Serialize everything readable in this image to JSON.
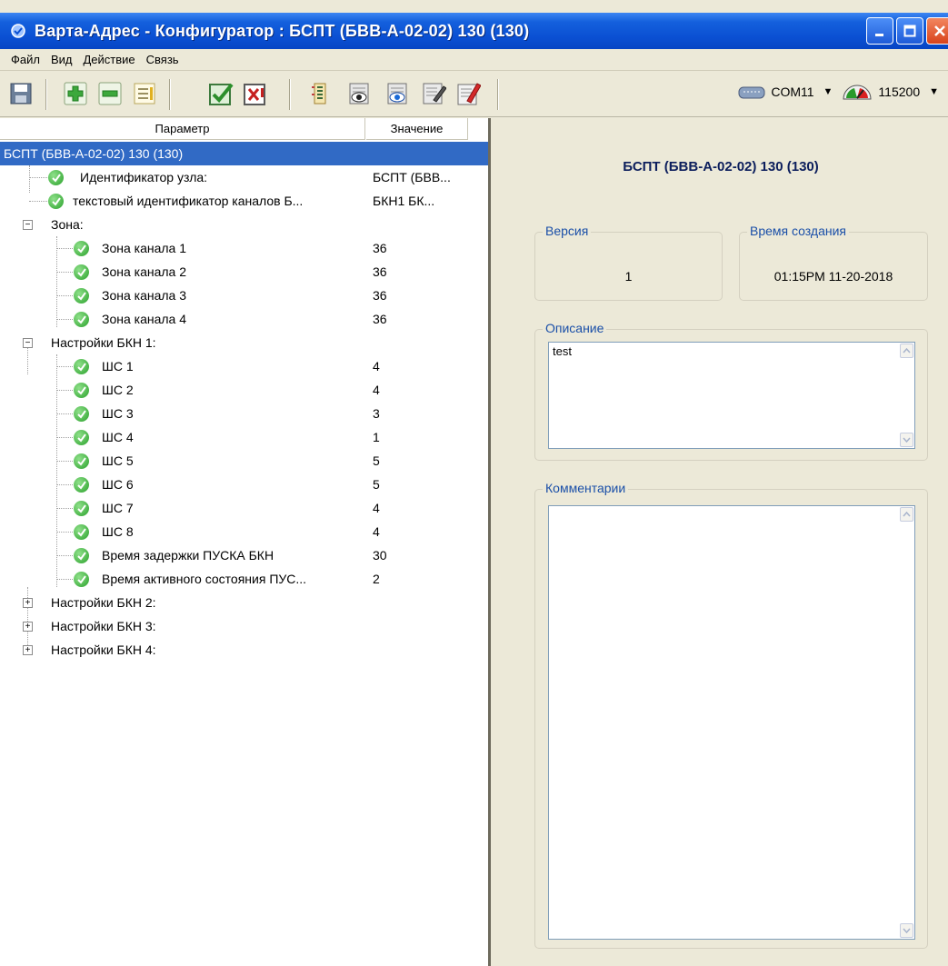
{
  "window": {
    "title": "Варта-Адрес - Конфигуратор : БСПТ (БВВ-А-02-02) 130 (130)"
  },
  "menu": [
    "Файл",
    "Вид",
    "Действие",
    "Связь"
  ],
  "toolbar": {
    "icons": [
      "save-icon",
      "add-icon",
      "remove-icon",
      "list-icon",
      "check-icon",
      "cancel-icon",
      "tree-icon",
      "read-icon",
      "view-icon",
      "write-icon",
      "edit-icon"
    ],
    "port": "COM11",
    "baud": "115200"
  },
  "tree": {
    "col_param": "Параметр",
    "col_value": "Значение",
    "root": "БСПТ (БВВ-А-02-02) 130 (130)",
    "node_id": {
      "label": "Идентификатор узла:",
      "value": "БСПТ (БВВ..."
    },
    "text_id": {
      "label": "текстовый идентификатор каналов Б...",
      "value": "БКН1   БК..."
    },
    "zone": {
      "label": "Зона:",
      "expander": "−",
      "items": [
        {
          "label": "Зона канала 1",
          "value": "36"
        },
        {
          "label": "Зона канала 2",
          "value": "36"
        },
        {
          "label": "Зона канала 3",
          "value": "36"
        },
        {
          "label": "Зона канала 4",
          "value": "36"
        }
      ]
    },
    "bkn1": {
      "label": "Настройки БКН 1:",
      "expander": "−",
      "items": [
        {
          "label": "ШС 1",
          "value": "4"
        },
        {
          "label": "ШС 2",
          "value": "4"
        },
        {
          "label": "ШС 3",
          "value": "3"
        },
        {
          "label": "ШС 4",
          "value": "1"
        },
        {
          "label": "ШС 5",
          "value": "5"
        },
        {
          "label": "ШС 6",
          "value": "5"
        },
        {
          "label": "ШС 7",
          "value": "4"
        },
        {
          "label": "ШС 8",
          "value": "4"
        },
        {
          "label": "Время задержки ПУСКА БКН",
          "value": "30"
        },
        {
          "label": "Время активного состояния ПУС...",
          "value": "2"
        }
      ]
    },
    "bkn2": {
      "label": "Настройки БКН 2:",
      "expander": "+"
    },
    "bkn3": {
      "label": "Настройки БКН 3:",
      "expander": "+"
    },
    "bkn4": {
      "label": "Настройки БКН 4:",
      "expander": "+"
    }
  },
  "details": {
    "title": "БСПТ (БВВ-А-02-02) 130 (130)",
    "version_label": "Версия",
    "version_value": "1",
    "created_label": "Время создания",
    "created_value": "01:15PM  11-20-2018",
    "description_label": "Описание",
    "description_value": "test",
    "comments_label": "Комментарии",
    "comments_value": ""
  },
  "colors": {
    "title_bar": "#0a4fd2",
    "selection": "#316ac5",
    "legend": "#1a4fa8",
    "check": "#2aa12b"
  }
}
